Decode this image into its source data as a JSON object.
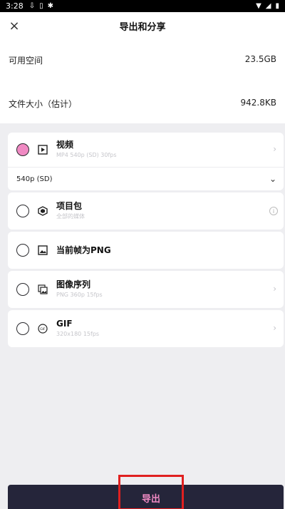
{
  "status_bar": {
    "time": "3:28",
    "icons": [
      "download-icon",
      "phone-icon",
      "notification-icon"
    ]
  },
  "header": {
    "title": "导出和分享",
    "close_icon": "×"
  },
  "info": {
    "available_space_label": "可用空间",
    "available_space_value": "23.5GB",
    "file_size_label": "文件大小（估计）",
    "file_size_value": "942.8KB"
  },
  "options": [
    {
      "label": "视频",
      "sub": "MP4 540p (SD) 30fps",
      "selected": true,
      "icon": "video-play-icon"
    },
    {
      "label": "项目包",
      "sub": "全部的媒体",
      "selected": false,
      "icon": "package-icon"
    },
    {
      "label": "当前帧为PNG",
      "sub": "",
      "selected": false,
      "icon": "image-icon"
    },
    {
      "label": "图像序列",
      "sub": "PNG 360p 15fps",
      "selected": false,
      "icon": "image-sequence-icon"
    },
    {
      "label": "GIF",
      "sub": "320x180 15fps",
      "selected": false,
      "icon": "gif-icon"
    }
  ],
  "video_quality": "540p (SD)",
  "export_label": "导出",
  "colors": {
    "accent": "#f08ac3",
    "bar": "#25253a",
    "highlight": "#e02020"
  }
}
